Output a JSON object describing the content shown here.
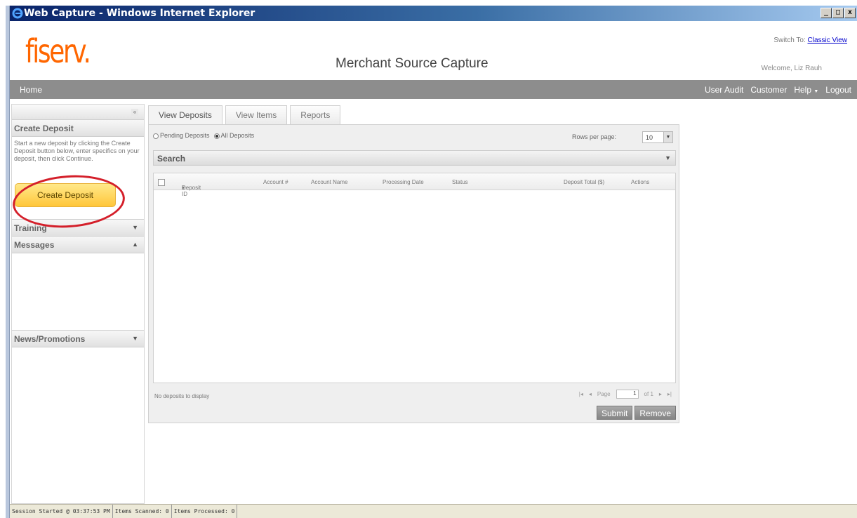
{
  "window": {
    "title": "Web Capture - Windows Internet Explorer",
    "controls": [
      "_",
      "□",
      "x"
    ]
  },
  "header": {
    "logo": "fiserv.",
    "app_title": "Merchant Source Capture",
    "switch_label": "Switch To:",
    "switch_link": "Classic View",
    "welcome": "Welcome, Liz Rauh"
  },
  "nav": {
    "home": "Home",
    "user_audit": "User Audit",
    "customer": "Customer",
    "help": "Help",
    "logout": "Logout"
  },
  "sidebar": {
    "collapse_icon": "«",
    "create_deposit": {
      "title": "Create Deposit",
      "text": "Start a new deposit by clicking the Create Deposit button below, enter specifics on your deposit, then click Continue.",
      "button": "Create Deposit"
    },
    "training": "Training",
    "messages": "Messages",
    "news": "News/Promotions"
  },
  "tabs": [
    "View Deposits",
    "View Items",
    "Reports"
  ],
  "filters": {
    "pending": "Pending Deposits",
    "all": "All Deposits",
    "selected": "All Deposits",
    "rows_label": "Rows per page:",
    "rows_value": "10"
  },
  "search": {
    "label": "Search"
  },
  "grid": {
    "columns": [
      "Deposit ID",
      "Account #",
      "Account Name",
      "Processing Date",
      "Status",
      "Deposit Total ($)",
      "Actions"
    ],
    "empty_text": "No deposits to display"
  },
  "pager": {
    "page_label": "Page",
    "page_value": "1",
    "of_label": "of 1"
  },
  "buttons": {
    "submit": "Submit",
    "remove": "Remove"
  },
  "status": {
    "session": "Session Started @ 03:37:53 PM",
    "scanned": "Items Scanned: 0",
    "processed": "Items Processed: 0"
  },
  "colors": {
    "logo": "#ff6600",
    "nav": "#8d8d8d",
    "annotation_oval": "#d41f2a",
    "button": "#ffc63a"
  }
}
